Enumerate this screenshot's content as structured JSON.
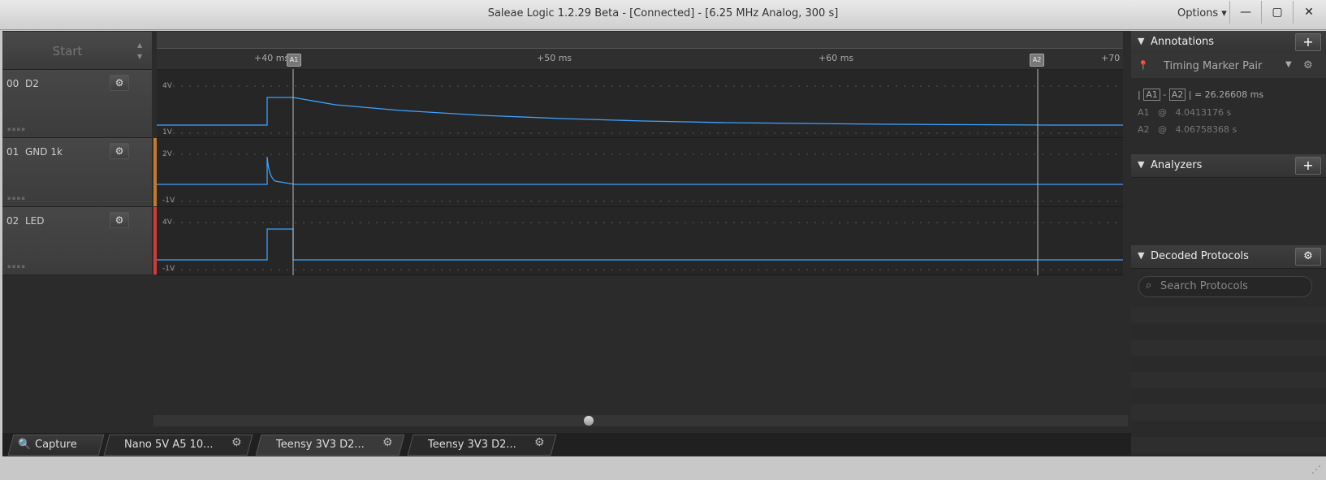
{
  "window": {
    "title": "Saleae Logic 1.2.29 Beta - [Connected] - [6.25 MHz Analog, 300 s]",
    "options_label": "Options ▾",
    "min": "—",
    "max": "▢",
    "close": "✕"
  },
  "capture": {
    "start_label": "Start"
  },
  "ruler": {
    "ticks": [
      "+40 ms",
      "+50 ms",
      "+60 ms",
      "+70"
    ],
    "marker_a1": "A1",
    "marker_a2": "A2"
  },
  "channels": [
    {
      "num": "00",
      "name": "D2",
      "vmax": "4V",
      "vmin": "1V"
    },
    {
      "num": "01",
      "name": "GND 1k",
      "vmax": "2V",
      "vmin": "-1V"
    },
    {
      "num": "02",
      "name": "LED",
      "vmax": "4V",
      "vmin": "-1V"
    }
  ],
  "tabs": {
    "capture": "Capture",
    "tab1": "Nano 5V A5 10...",
    "tab2": "Teensy 3V3 D2...",
    "tab3": "Teensy 3V3 D2..."
  },
  "annotations": {
    "title": "Annotations",
    "pair_label": "Timing Marker Pair",
    "a1": "A1",
    "a2": "A2",
    "dash": "-",
    "eq": "| = 26.26608 ms",
    "a1_time": "4.0413176 s",
    "a2_time": "4.06758368 s",
    "at": "@"
  },
  "analyzers": {
    "title": "Analyzers"
  },
  "decoded": {
    "title": "Decoded Protocols",
    "search_placeholder": "Search Protocols"
  },
  "colors": {
    "trace": "#3ea2ff",
    "accent_orange": "#c47a2a",
    "accent_red": "#d23a3a"
  }
}
